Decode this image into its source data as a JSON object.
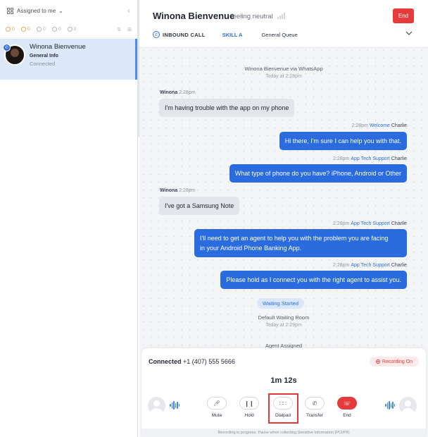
{
  "sidebar": {
    "filter_label": "Assigned to me",
    "collapse_icon": "chevron-left-icon",
    "counts": [
      "0",
      "0",
      "0",
      "0",
      "0"
    ],
    "contact": {
      "name": "Winona Bienvenue",
      "info": "General Info",
      "status": "Connected"
    }
  },
  "header": {
    "name": "Winona Bienvenue",
    "mood": "feeling neutral",
    "end_label": "End",
    "call_type": "INBOUND CALL",
    "skill": "SKILL A",
    "queue": "General Queue"
  },
  "chat": {
    "origin": "Winona Bienvenue via WhatsApp",
    "origin_time": "Today at 2:28pm",
    "messages": [
      {
        "dir": "in",
        "who": "Winona",
        "time": "2:28pm",
        "text": "I'm having trouble with the app on my phone"
      },
      {
        "dir": "out",
        "time": "2:28pm",
        "team": "Welcome",
        "agent": "Charlie",
        "text": "Hi there, I'm sure I can help you with that."
      },
      {
        "dir": "out",
        "time": "2:28pm",
        "team": "App Tech Support",
        "agent": "Charlie",
        "text": "What type of phone do you have? iPhone, Android or Other"
      },
      {
        "dir": "in",
        "who": "Winona",
        "time": "2:28pm",
        "text": "I've got a Samsung Note"
      },
      {
        "dir": "out",
        "time": "2:28pm",
        "team": "App Tech Support",
        "agent": "Charlie",
        "text_line1": "I'll need to get an agent to help you with the problem you are facing",
        "text_line2": "in your Android Phone Banking App."
      },
      {
        "dir": "out",
        "time": "2:28pm",
        "team": "App Tech Support",
        "agent": "Charlie",
        "text": "Please hold as I connect you with the right agent to assist you."
      }
    ],
    "waiting_pill": "Waiting Started",
    "waiting_room": "Default Waiting Room",
    "waiting_time": "Today at 2:29pm",
    "agent_assigned": "Agent Assigned"
  },
  "call": {
    "status": "Connected",
    "number": "+1 (407) 555 5666",
    "recording": "Recording On",
    "duration": "1m 12s",
    "controls": [
      {
        "label": "Mute",
        "icon": "microphone-icon"
      },
      {
        "label": "Hold",
        "icon": "pause-icon"
      },
      {
        "label": "Dialpad",
        "icon": "dialpad-icon"
      },
      {
        "label": "Transfer",
        "icon": "transfer-icon"
      },
      {
        "label": "End",
        "icon": "hangup-icon"
      }
    ],
    "footnote": "Recording in progress. Pause when collecting Sensitive Information (PCI/PII)"
  },
  "colors": {
    "accent": "#2a6ce0",
    "danger": "#e53b3b",
    "selected_row": "#dce7f7"
  }
}
